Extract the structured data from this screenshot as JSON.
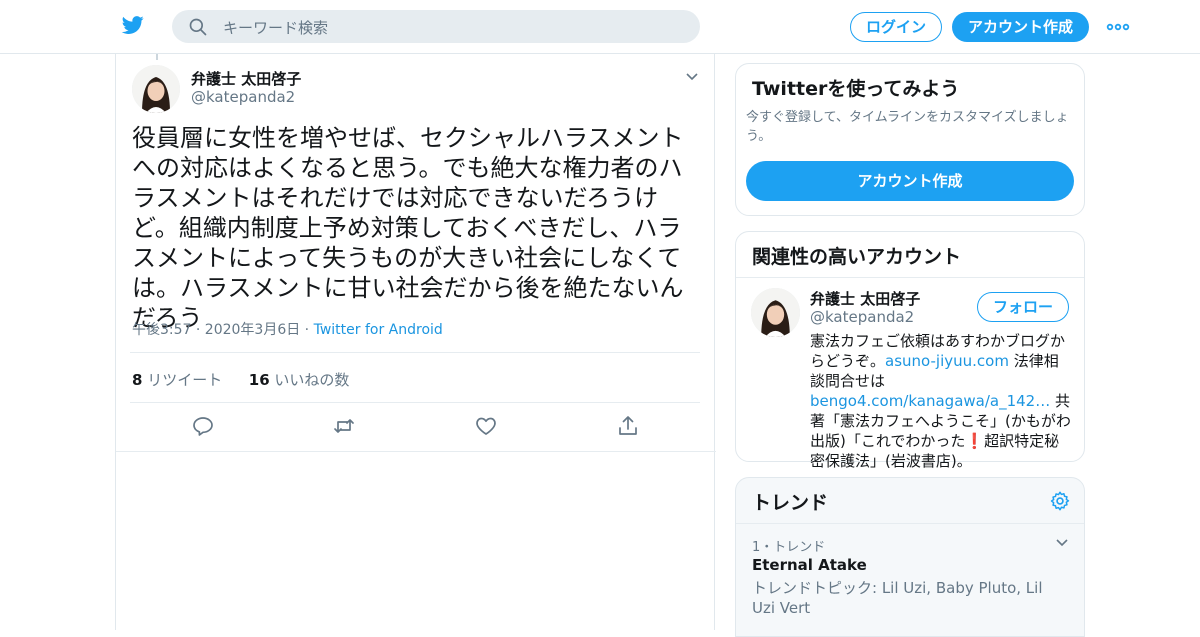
{
  "header": {
    "search_placeholder": "キーワード検索",
    "login_label": "ログイン",
    "signup_label": "アカウント作成",
    "brand_color": "#1da1f2"
  },
  "tweet": {
    "name": "弁護士 太田啓子",
    "handle": "@katepanda2",
    "text": "役員層に女性を増やせば、セクシャルハラスメントへの対応はよくなると思う。でも絶大な権力者のハラスメントはそれだけでは対応できないだろうけど。組織内制度上予め対策しておくべきだし、ハラスメントによって失うものが大きい社会にしなくては。ハラスメントに甘い社会だから後を絶たないんだろう",
    "timestamp": "午後3:57 · 2020年3月6日 · ",
    "source": "Twitter for Android",
    "retweets_count": "8",
    "retweets_label": " リツイート",
    "likes_count": "16",
    "likes_label": " いいねの数"
  },
  "signup_card": {
    "title": "Twitterを使ってみよう",
    "description": "今すぐ登録して、タイムラインをカスタマイズしましょう。",
    "button_label": "アカウント作成"
  },
  "related": {
    "title": "関連性の高いアカウント",
    "name": "弁護士 太田啓子",
    "handle": "@katepanda2",
    "follow_label": "フォロー",
    "bio_part1": "憲法カフェご依頼はあすわかブログからどうぞ。",
    "bio_link1": "asuno-jiyuu.com",
    "bio_part2": " 法律相談問合せは",
    "bio_link2": "bengo4.com/kanagawa/a_142…",
    "bio_part3": " 共著「憲法カフェへようこそ」(かもがわ出版)「これでわかった❗超訳特定秘密保護法」(岩波書店)。"
  },
  "trends": {
    "title": "トレンド",
    "items": [
      {
        "rank": "1・トレンド",
        "title": "Eternal Atake",
        "topic": "トレンドトピック: Lil Uzi, Baby Pluto, Lil Uzi Vert"
      }
    ]
  }
}
